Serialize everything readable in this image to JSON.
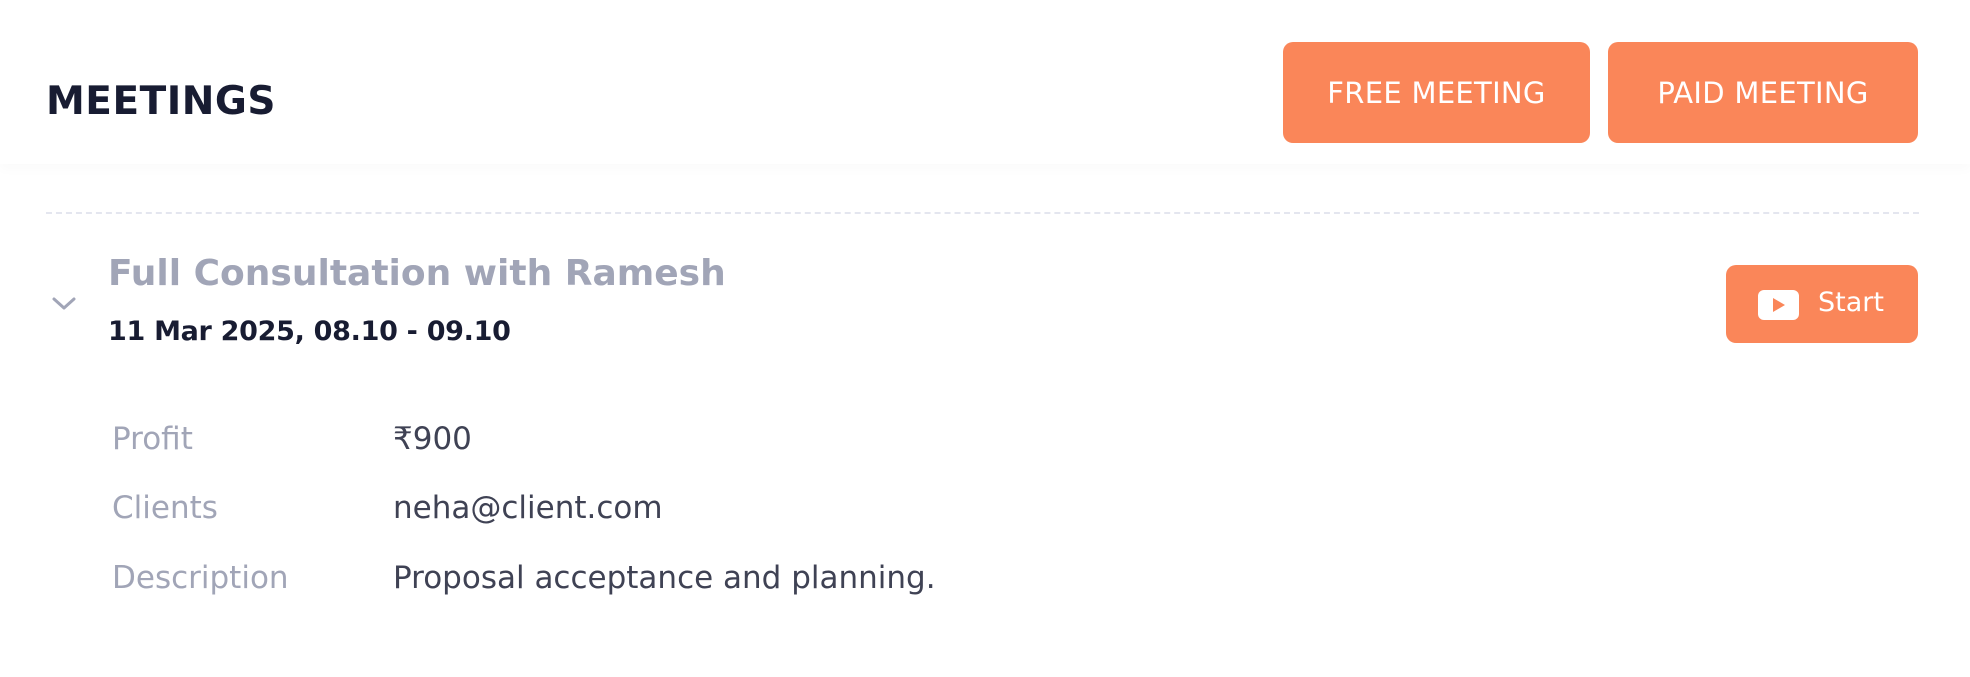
{
  "header": {
    "title": "MEETINGS",
    "free_meeting_label": "FREE MEETING",
    "paid_meeting_label": "PAID MEETING"
  },
  "meeting": {
    "title": "Full Consultation with Ramesh",
    "datetime": "11 Mar 2025, 08.10 - 09.10",
    "start_label": "Start",
    "expanded": true,
    "details": {
      "profit_label": "Profit",
      "profit_value": "₹900",
      "clients_label": "Clients",
      "clients_value": "neha@client.com",
      "description_label": "Description",
      "description_value": "Proposal acceptance and planning."
    }
  },
  "icons": {
    "expand": "chevron-down-icon",
    "start": "play-video-icon"
  },
  "colors": {
    "accent": "#fa8659",
    "title_dark": "#181c32",
    "muted": "#a1a5b7",
    "text": "#3f4254"
  }
}
